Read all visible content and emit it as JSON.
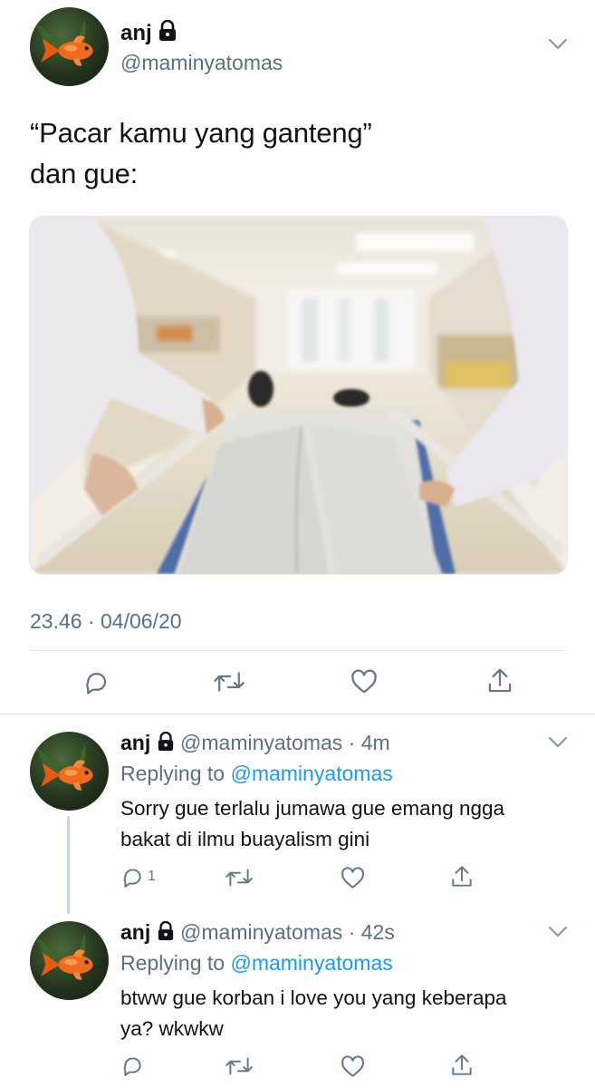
{
  "tweet": {
    "author_name": "anj",
    "author_handle": "@maminyatomas",
    "text_line1": "“Pacar kamu yang ganteng”",
    "text_line2": "dan gue:",
    "timestamp": "23.46 · 04/06/20",
    "icons": [
      "reply-icon",
      "retweet-icon",
      "like-icon",
      "share-icon"
    ]
  },
  "replies": [
    {
      "author_name": "anj",
      "handle_time": "@maminyatomas · 4m",
      "replying_prefix": "Replying to",
      "replying_handle": "@maminyatomas",
      "text_line1": "Sorry gue terlalu jumawa gue emang ngga",
      "text_line2": "bakat di ilmu buayalism gini",
      "reply_count": "1"
    },
    {
      "author_name": "anj",
      "handle_time": "@maminyatomas · 42s",
      "replying_prefix": "Replying to",
      "replying_handle": "@maminyatomas",
      "text_line1": "btww gue korban i love you yang keberapa",
      "text_line2": "ya? wkwkw",
      "reply_count": ""
    }
  ],
  "colors": {
    "link": "#1d9bf0",
    "secondary": "#5b7083",
    "divider": "#e1e8ed",
    "text": "#0f1419"
  }
}
